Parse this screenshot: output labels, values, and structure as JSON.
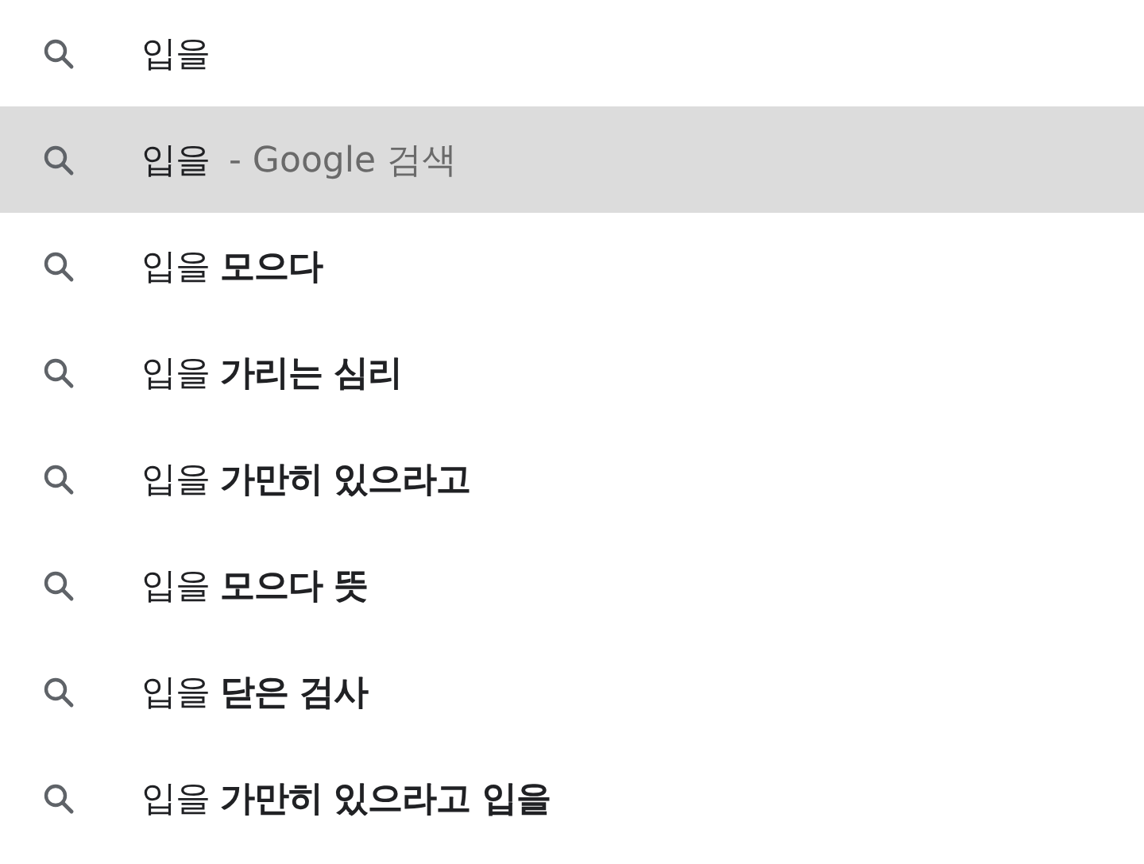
{
  "suggestions": [
    {
      "kind": "query",
      "text": "입을",
      "selected": false
    },
    {
      "kind": "search",
      "text": "입을",
      "description": "- Google 검색",
      "selected": true
    },
    {
      "kind": "query",
      "text": "입을 **모으다**",
      "selected": false
    },
    {
      "kind": "query",
      "text": "입을 **가리는 심리**",
      "selected": false
    },
    {
      "kind": "query",
      "text": "입을 **가만히 있으라고**",
      "selected": false
    },
    {
      "kind": "query",
      "text": "입을 **모으다 뜻**",
      "selected": false
    },
    {
      "kind": "query",
      "text": "입을 **닫은 검사**",
      "selected": false
    },
    {
      "kind": "query",
      "text": "입을 **가만히 있으라고 입을**",
      "selected": false
    }
  ]
}
